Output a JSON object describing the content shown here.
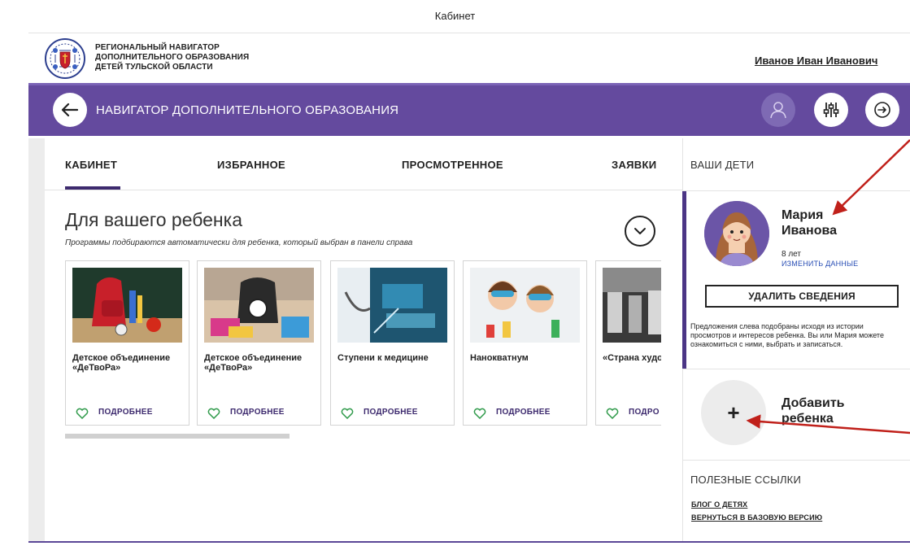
{
  "window": {
    "title": "Кабинет"
  },
  "header": {
    "logo_lines": [
      "РЕГИОНАЛЬНЫЙ НАВИГАТОР",
      "ДОПОЛНИТЕЛЬНОГО ОБРАЗОВАНИЯ",
      "ДЕТЕЙ ТУЛЬСКОЙ ОБЛАСТИ"
    ],
    "user_name": "Иванов Иван Иванович"
  },
  "navbar": {
    "title": "НАВИГАТОР ДОПОЛНИТЕЛЬНОГО ОБРАЗОВАНИЯ",
    "back_icon": "arrow-left-icon",
    "user_icon": "user-icon",
    "filter_icon": "sliders-icon",
    "exit_icon": "logout-icon"
  },
  "tabs": [
    {
      "label": "КАБИНЕТ",
      "active": true
    },
    {
      "label": "ИЗБРАННОЕ",
      "active": false
    },
    {
      "label": "ПРОСМОТРЕННОЕ",
      "active": false
    },
    {
      "label": "ЗАЯВКИ",
      "active": false
    }
  ],
  "section": {
    "title": "Для вашего ребенка",
    "subtitle": "Программы подбираются автоматически для ребенка, который выбран в панели справа"
  },
  "cards": [
    {
      "title": "Детское объединение «ДеТвоРа»",
      "more": "ПОДРОБНЕЕ"
    },
    {
      "title": "Детское объединение «ДеТвоРа»",
      "more": "ПОДРОБНЕЕ"
    },
    {
      "title": "Ступени к медицине",
      "more": "ПОДРОБНЕЕ"
    },
    {
      "title": "Нанокватнум",
      "more": "ПОДРОБНЕЕ"
    },
    {
      "title": "«Страна художнико",
      "more": "ПОДРО"
    }
  ],
  "right_panel": {
    "heading": "ВАШИ ДЕТИ",
    "child": {
      "first_name": "Мария",
      "last_name": "Иванова",
      "age": "8 лет",
      "edit_label": "ИЗМЕНИТЬ ДАННЫЕ",
      "delete_label": "УДАЛИТЬ СВЕДЕНИЯ",
      "note": "Предложения слева подобраны исходя из истории просмотров и интересов ребенка. Вы или Мария можете ознакомиться с ними, выбрать и записаться."
    },
    "add_child": {
      "plus": "+",
      "line1": "Добавить",
      "line2": "ребенка"
    },
    "links_heading": "ПОЛЕЗНЫЕ ССЫЛКИ",
    "links": [
      "БЛОГ О ДЕТЯХ",
      "ВЕРНУТЬСЯ В БАЗОВУЮ ВЕРСИЮ"
    ]
  },
  "colors": {
    "nav_purple": "#644a9e",
    "accent_dark": "#3d2a6e",
    "link_blue": "#2a4fb5",
    "annotation_red": "#c0201a"
  }
}
